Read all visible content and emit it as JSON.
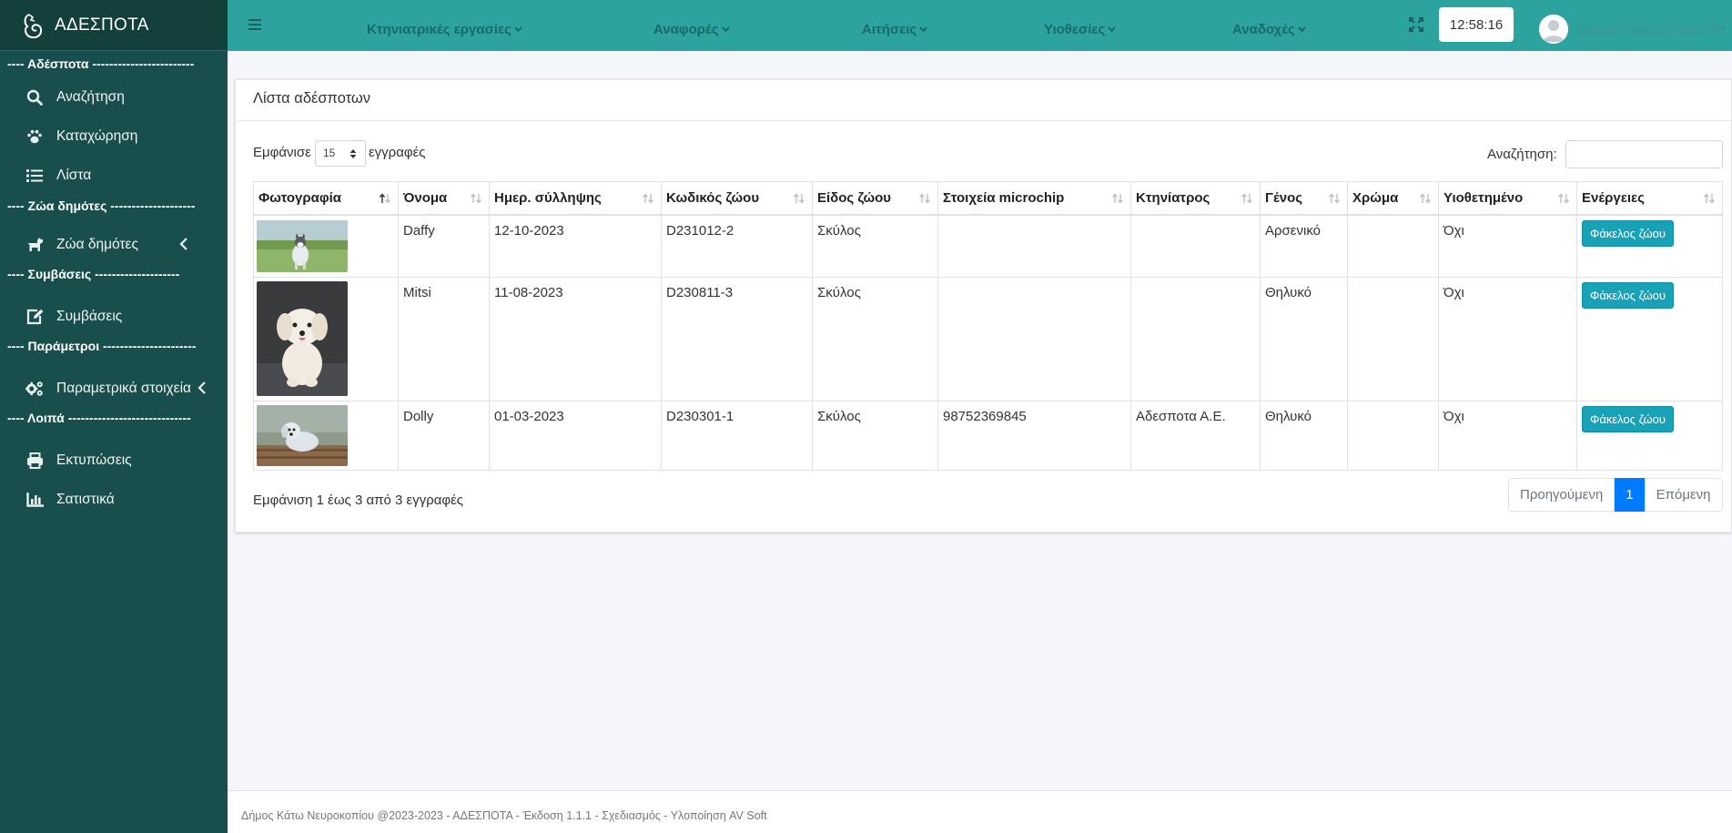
{
  "app": {
    "brand": "ΑΔΕΣΠΟΤΑ"
  },
  "sidebar": {
    "sections": [
      {
        "header": "---- Αδέσποτα ------------------------",
        "items": [
          {
            "label": "Αναζήτηση",
            "icon": "search-icon"
          },
          {
            "label": "Καταχώρηση",
            "icon": "paw-icon"
          },
          {
            "label": "Λίστα",
            "icon": "list-icon"
          }
        ]
      },
      {
        "header": "---- Ζώα δημότες --------------------",
        "items": [
          {
            "label": "Ζώα δημότες",
            "icon": "dog-icon",
            "has_submenu": true
          }
        ]
      },
      {
        "header": "---- Συμβάσεις --------------------",
        "items": [
          {
            "label": "Συμβάσεις",
            "icon": "edit-icon"
          }
        ]
      },
      {
        "header": "---- Παράμετροι ----------------------",
        "items": [
          {
            "label": "Παραμετρικά στοιχεία",
            "icon": "cogs-icon",
            "has_submenu": true
          }
        ]
      },
      {
        "header": "---- Λοιπά -----------------------------",
        "items": [
          {
            "label": "Εκτυπώσεις",
            "icon": "print-icon"
          },
          {
            "label": "Σατιστικά",
            "icon": "bar-chart-icon"
          }
        ]
      }
    ]
  },
  "topbar": {
    "menus": [
      "Κτηνιατρικές εργασίες",
      "Αναφορές",
      "Αιτήσεις",
      "Υιοθεσίες",
      "Αναδοχές"
    ],
    "clock": "12:58:16",
    "username": "Ονοματεπώνυμο Χρήστη"
  },
  "card": {
    "title": "Λίστα αδέσποτων",
    "show_label": "Εμφάνισε",
    "page_length": "15",
    "records_label": "εγγραφές",
    "search_label": "Αναζήτηση:",
    "columns": [
      "Φωτογραφία",
      "Όνομα",
      "Ημερ. σύλληψης",
      "Κωδικός ζώου",
      "Είδος ζώου",
      "Στοιχεία microchip",
      "Κτηνίατρος",
      "Γένος",
      "Χρώμα",
      "Υιοθετημένο",
      "Ενέργειες"
    ],
    "rows": [
      {
        "name": "Daffy",
        "capture_date": "12-10-2023",
        "code": "D231012-2",
        "species": "Σκύλος",
        "microchip": "",
        "vet": "",
        "gender": "Αρσενικό",
        "color": "",
        "adopted": "Όχι",
        "action": "Φάκελος ζώου"
      },
      {
        "name": "Mitsi",
        "capture_date": "11-08-2023",
        "code": "D230811-3",
        "species": "Σκύλος",
        "microchip": "",
        "vet": "",
        "gender": "Θηλυκό",
        "color": "",
        "adopted": "Όχι",
        "action": "Φάκελος ζώου"
      },
      {
        "name": "Dolly",
        "capture_date": "01-03-2023",
        "code": "D230301-1",
        "species": "Σκύλος",
        "microchip": "98752369845",
        "vet": "Αδεσποτα Α.Ε.",
        "gender": "Θηλυκό",
        "color": "",
        "adopted": "Όχι",
        "action": "Φάκελος ζώου"
      }
    ],
    "info": "Εμφάνιση 1 έως 3 από 3 εγγραφές",
    "pagination": {
      "prev": "Προηγούμενη",
      "current": "1",
      "next": "Επόμενη"
    }
  },
  "footer": "Δήμος Κάτω Νευροκοπίου @2023-2023 - ΑΔΕΣΠΟΤΑ - Έκδοση 1.1.1 - Σχεδιασμός - Υλοποίηση AV Soft",
  "colors": {
    "sidebar": "#184f4d",
    "topbar": "#2da3a0",
    "action_button": "#17a2b8",
    "active_page": "#007bff"
  }
}
